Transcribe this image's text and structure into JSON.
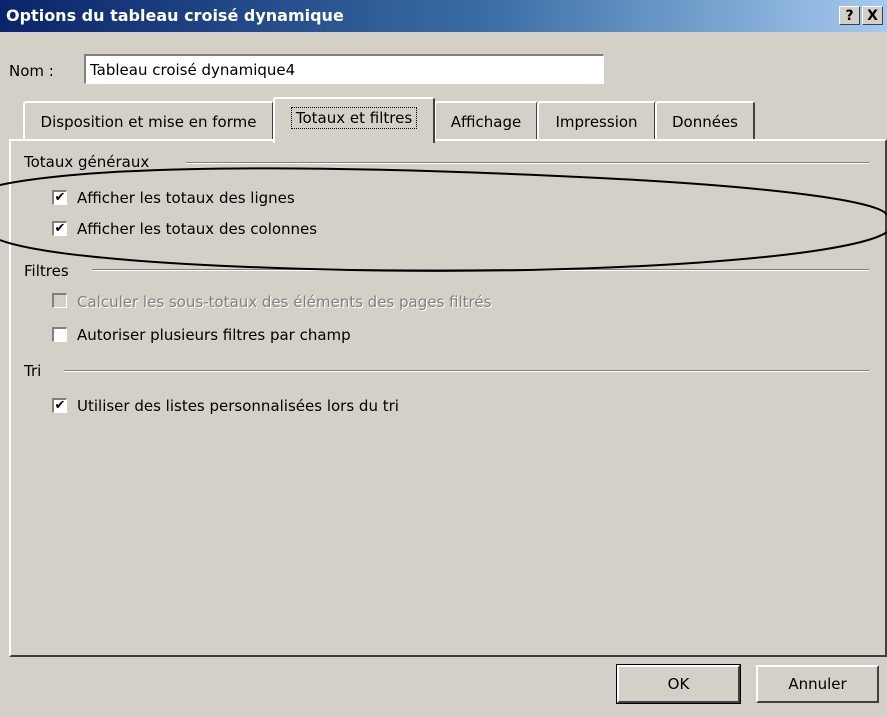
{
  "window": {
    "title": "Options du tableau croisé dynamique",
    "help_label": "?",
    "close_label": "X"
  },
  "name": {
    "label": "Nom :",
    "value": "Tableau croisé dynamique4"
  },
  "tabs": [
    {
      "label": "Disposition et mise en forme",
      "active": false
    },
    {
      "label": "Totaux et filtres",
      "active": true
    },
    {
      "label": "Affichage",
      "active": false
    },
    {
      "label": "Impression",
      "active": false
    },
    {
      "label": "Données",
      "active": false
    }
  ],
  "sections": {
    "totals": {
      "title": "Totaux généraux",
      "options": [
        {
          "label": "Afficher les totaux des lignes",
          "checked": true,
          "enabled": true
        },
        {
          "label": "Afficher les totaux des colonnes",
          "checked": true,
          "enabled": true
        }
      ]
    },
    "filters": {
      "title": "Filtres",
      "options": [
        {
          "label": "Calculer les sous-totaux des éléments des pages filtrés",
          "checked": false,
          "enabled": false
        },
        {
          "label": "Autoriser plusieurs filtres par champ",
          "checked": false,
          "enabled": true
        }
      ]
    },
    "sort": {
      "title": "Tri",
      "options": [
        {
          "label": "Utiliser des listes personnalisées lors du tri",
          "checked": true,
          "enabled": true
        }
      ]
    }
  },
  "buttons": {
    "ok": "OK",
    "cancel": "Annuler"
  },
  "check_glyph": "✔",
  "colors": {
    "title_gradient_start": "#0a246a",
    "title_gradient_end": "#a6caf0",
    "face": "#d4d0c8"
  }
}
